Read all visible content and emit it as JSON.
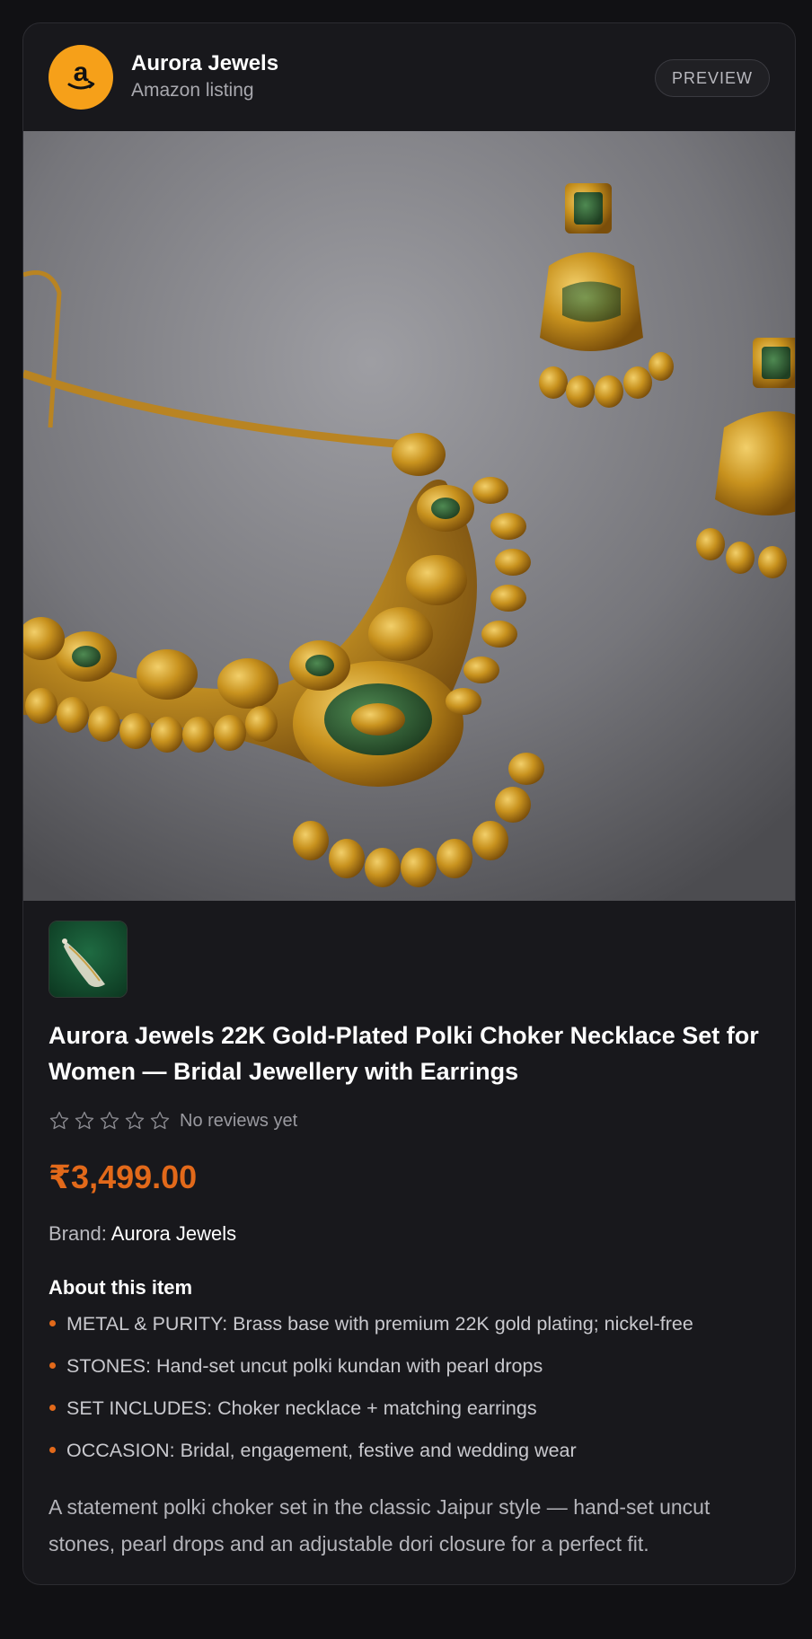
{
  "header": {
    "store_name": "Aurora Jewels",
    "store_sub": "Amazon listing",
    "logo_letter": "a",
    "preview_label": "PREVIEW"
  },
  "product": {
    "hero_image": "gold polki choker necklace set with earrings",
    "title": "Aurora Jewels 22K Gold-Plated Polki Choker Necklace Set for Women — Bridal Jewellery with Earrings",
    "rating_stars": 0,
    "rating_text": "No reviews yet",
    "price": "₹3,499.00",
    "brand_label": "Brand:",
    "brand_value": "Aurora Jewels",
    "about_heading": "About this item",
    "bullets": [
      "METAL & PURITY: Brass base with premium 22K gold plating; nickel-free",
      "STONES: Hand-set uncut polki kundan with pearl drops",
      "SET INCLUDES: Choker necklace + matching earrings",
      "OCCASION: Bridal, engagement, festive and wedding wear"
    ],
    "description": "A statement polki choker set in the classic Jaipur style — hand-set uncut stones, pearl drops and an adjustable dori closure for a perfect fit."
  },
  "colors": {
    "accent": "#e2691a",
    "logo_bg": "#f6a019",
    "card_bg": "#18181c",
    "page_bg": "#111114"
  }
}
